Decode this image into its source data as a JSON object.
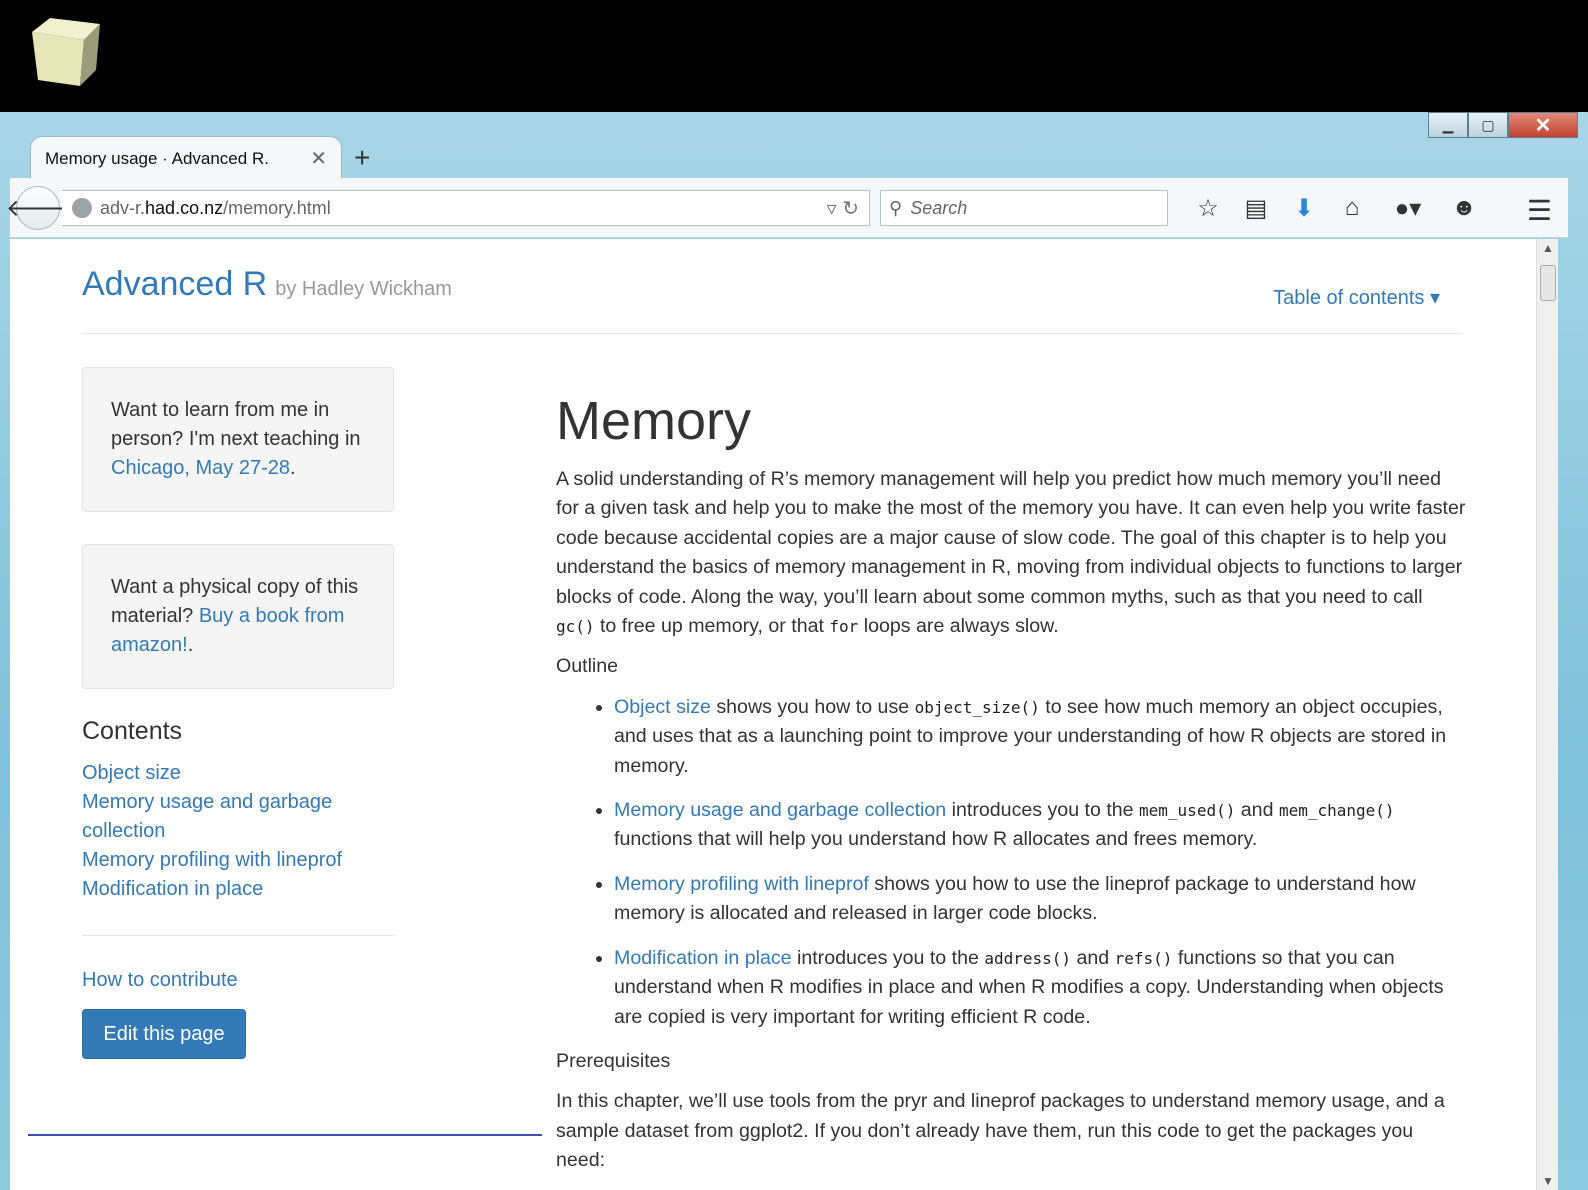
{
  "browser": {
    "tab_title": "Memory usage · Advanced R.",
    "tab_close": "✕",
    "new_tab": "+",
    "url_prefix": "adv-r.",
    "url_host": "had.co.nz",
    "url_path": "/memory.html",
    "search_placeholder": "Search",
    "toolbar_icons": [
      "star-icon",
      "reading-list-icon",
      "download-icon",
      "home-icon",
      "adblock-icon",
      "chat-icon",
      "menu-icon"
    ]
  },
  "site": {
    "title": "Advanced R",
    "byline": "by Hadley Wickham",
    "toc_toggle": "Table of contents"
  },
  "sidebar": {
    "well1": {
      "text": "Want to learn from me in person? I'm next teaching in ",
      "link": "Chicago, May 27-28",
      "end": "."
    },
    "well2": {
      "text": "Want a physical copy of this material? ",
      "link": "Buy a book from amazon!",
      "end": "."
    },
    "contents_heading": "Contents",
    "contents": [
      "Object size",
      "Memory usage and garbage collection",
      "Memory profiling with lineprof",
      "Modification in place"
    ],
    "contribute": "How to contribute",
    "edit_button": "Edit this page"
  },
  "main": {
    "heading": "Memory",
    "intro_1": "A solid understanding of R’s memory management will help you predict how much memory you’ll need for a given task and help you to make the most of the memory you have. It can even help you write faster code because accidental copies are a major cause of slow code. The goal of this chapter is to help you understand the basics of memory management in R, moving from individual objects to functions to larger blocks of code. Along the way, you’ll learn about some common myths, such as that you need to call ",
    "intro_code1": "gc()",
    "intro_2": " to free up memory, or that ",
    "intro_code2": "for",
    "intro_3": " loops are always slow.",
    "outline_label": "Outline",
    "outline": [
      {
        "link": "Object size",
        "t1": " shows you how to use ",
        "c1": "object_size()",
        "t2": " to see how much memory an object occupies, and uses that as a launching point to improve your understanding of how R objects are stored in memory."
      },
      {
        "link": "Memory usage and garbage collection",
        "t1": " introduces you to the ",
        "c1": "mem_used()",
        "t2": " and ",
        "c2": "mem_change()",
        "t3": " functions that will help you understand how R allocates and frees memory."
      },
      {
        "link": "Memory profiling with lineprof",
        "t1": " shows you how to use the lineprof package to understand how memory is allocated and released in larger code blocks."
      },
      {
        "link": "Modification in place",
        "t1": " introduces you to the ",
        "c1": "address()",
        "t2": " and ",
        "c2": "refs()",
        "t3": " functions so that you can understand when R modifies in place and when R modifies a copy. Understanding when objects are copied is very important for writing efficient R code."
      }
    ],
    "prereq_label": "Prerequisites",
    "prereq_text": "In this chapter, we’ll use tools from the pryr and lineprof packages to understand memory usage, and a sample dataset from ggplot2. If you don’t already have them, run this code to get the packages you need:"
  },
  "colors": {
    "link": "#337ab7",
    "text": "#333333",
    "button": "#337ab7"
  }
}
